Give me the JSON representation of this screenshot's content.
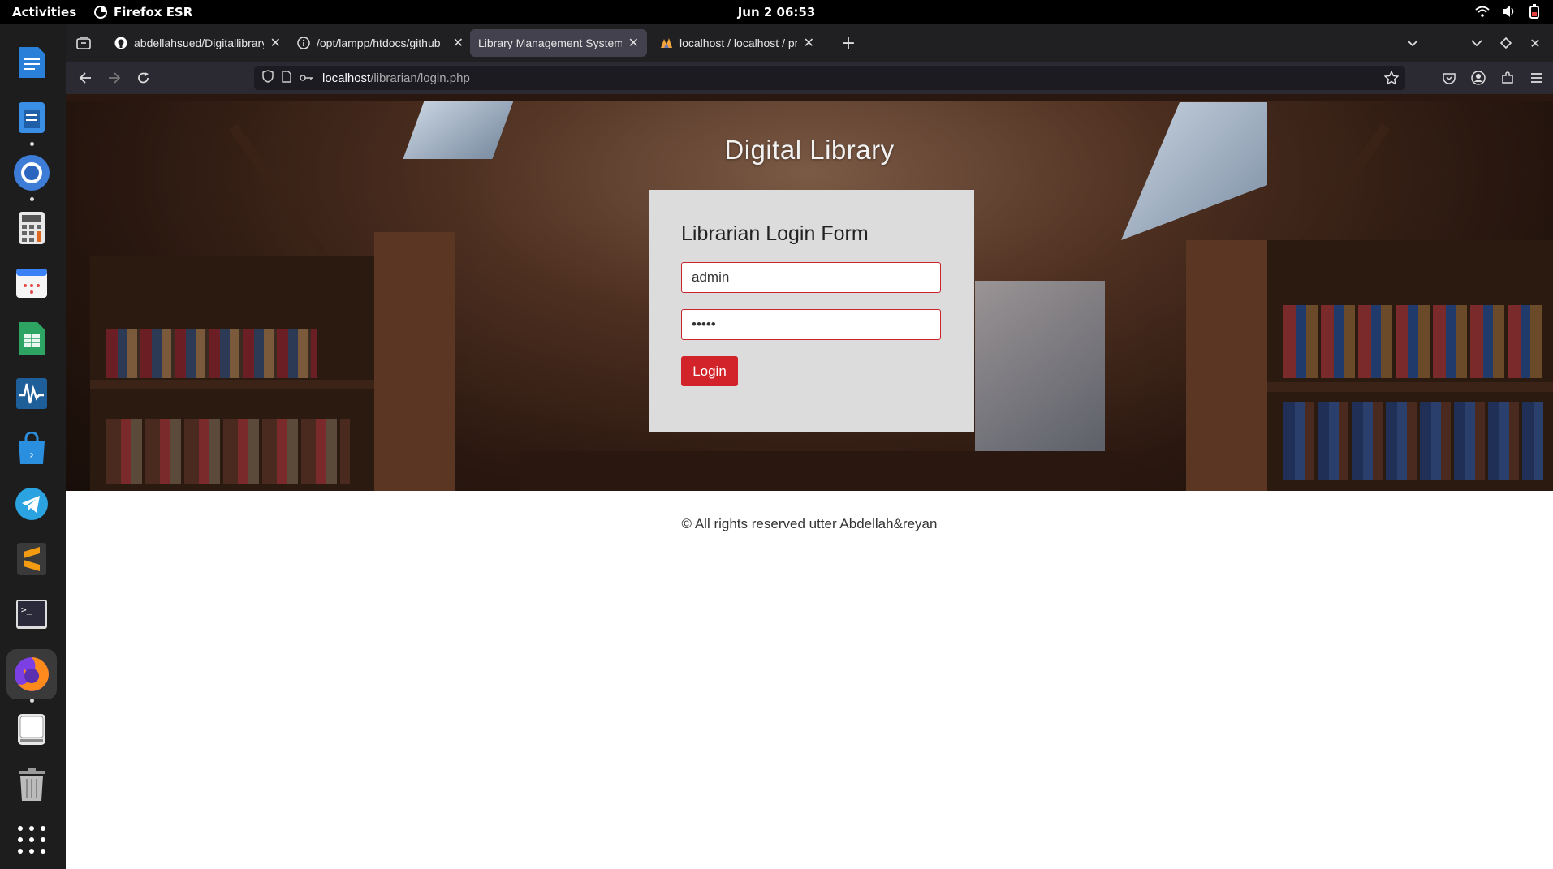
{
  "system": {
    "activities_label": "Activities",
    "app_name": "Firefox ESR",
    "clock": "Jun 2  06:53"
  },
  "dock": {
    "items": [
      "text-editor-icon",
      "notes-icon",
      "chromium-icon",
      "calculator-icon",
      "calendar-icon",
      "spreadsheet-icon",
      "system-monitor-icon",
      "app-store-icon",
      "telegram-icon",
      "sublime-text-icon",
      "terminal-icon",
      "firefox-icon",
      "drive-icon",
      "trash-icon",
      "app-grid-icon"
    ]
  },
  "browser": {
    "tabs": [
      {
        "label": "abdellahsued/Digitallibrary",
        "icon": "github-icon"
      },
      {
        "label": "/opt/lampp/htdocs/github",
        "icon": "info-icon"
      },
      {
        "label": "Library Management System",
        "icon": ""
      },
      {
        "label": "localhost / localhost / proje",
        "icon": "phpmyadmin-icon"
      }
    ],
    "active_tab": 2,
    "url_host": "localhost",
    "url_path": "/librarian/login.php"
  },
  "page": {
    "site_title": "Digital Library",
    "form_title": "Librarian Login Form",
    "username_value": "admin",
    "password_value": "•••••",
    "login_label": "Login",
    "footer_text": "© All rights reserved utter Abdellah&reyan"
  },
  "colors": {
    "accent_red": "#d2232a",
    "card_bg": "#dcdcdc"
  }
}
